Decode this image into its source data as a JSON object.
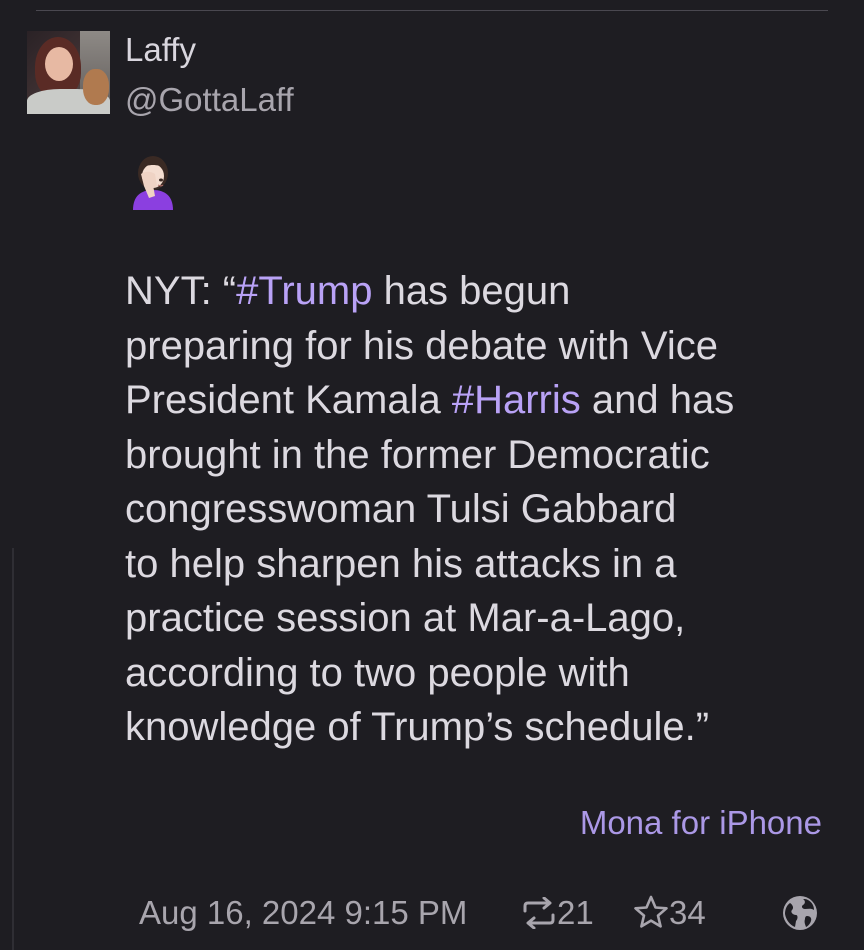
{
  "author": {
    "display_name": "Laffy",
    "handle": "@GottaLaff"
  },
  "post": {
    "emoji": "🤦🏻‍♀️",
    "text_parts": [
      "NYT: “",
      "#Trump",
      " has begun\npreparing for his debate with Vice\nPresident Kamala ",
      "#Harris",
      " and has\nbrought in the former Democratic\ncongresswoman Tulsi Gabbard\nto help sharpen his attacks in a\npractice session at Mar-a-Lago,\naccording to two people with\nknowledge of Trump’s schedule.”"
    ],
    "client": "Mona for iPhone"
  },
  "meta": {
    "timestamp": "Aug 16, 2024 9:15 PM",
    "boosts": "21",
    "favorites": "34"
  },
  "icons": {
    "boost": "repeat-icon",
    "favorite": "star-icon",
    "visibility": "globe-icon"
  },
  "colors": {
    "background": "#1e1d22",
    "hashtag": "#b9a2f6",
    "client_link": "#ab98e6",
    "text": "#dcd9e0",
    "secondary": "#a8a5ad"
  }
}
